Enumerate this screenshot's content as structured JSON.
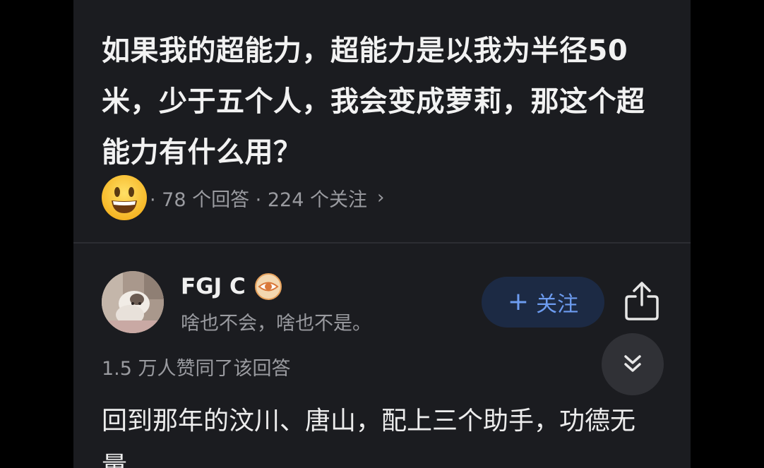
{
  "question": {
    "title": "如果我的超能力，超能力是以我为半径50米，少于五个人，我会变成萝莉，那这个超能力有什么用？",
    "emoji_icon": "grinning-face-emoji",
    "meta": "· 78 个回答 · 224 个关注",
    "chevron": "›"
  },
  "answer": {
    "author": {
      "name": "FGJ C",
      "badge_icon": "eye-badge-icon",
      "bio": "啥也不会，啥也不是。"
    },
    "follow_button": {
      "plus": "+",
      "label": "关注"
    },
    "share_icon": "share-icon",
    "scroll_icon": "double-chevron-down-icon",
    "approval": "1.5 万人赞同了该回答",
    "text": "回到那年的汶川、唐山，配上三个助手，功德无量。"
  },
  "colors": {
    "background": "#1b1c20",
    "accent": "#6d9cf0",
    "follow_button_bg": "#1c2a44",
    "secondary_text": "#9a9ba0"
  }
}
